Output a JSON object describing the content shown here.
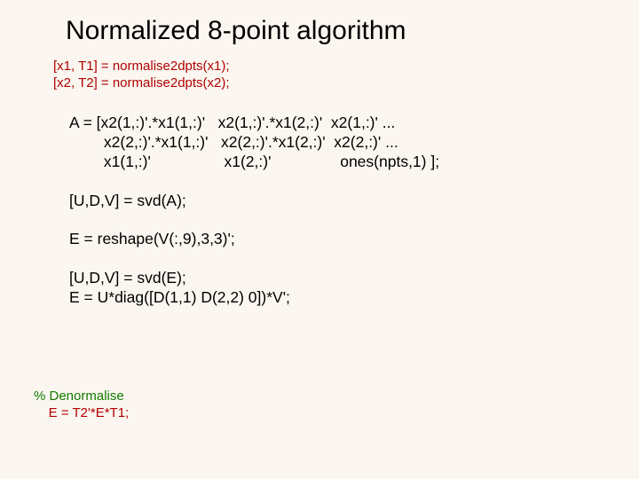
{
  "title": "Normalized 8-point algorithm",
  "norm": {
    "line1": "[x1, T1] = normalise2dpts(x1);",
    "line2": "[x2, T2] = normalise2dpts(x2);"
  },
  "code": {
    "a1": "A = [x2(1,:)'.*x1(1,:)'   x2(1,:)'.*x1(2,:)'  x2(1,:)' ...",
    "a2": "        x2(2,:)'.*x1(1,:)'   x2(2,:)'.*x1(2,:)'  x2(2,:)' ...",
    "a3": "        x1(1,:)'                 x1(2,:)'                ones(npts,1) ];",
    "svdA": "[U,D,V] = svd(A);",
    "resh": "E = reshape(V(:,9),3,3)';",
    "svdE": "[U,D,V] = svd(E);",
    "diag": "E = U*diag([D(1,1) D(2,2) 0])*V';"
  },
  "denorm": {
    "comment": "% Denormalise",
    "line": "    E = T2'*E*T1;"
  }
}
